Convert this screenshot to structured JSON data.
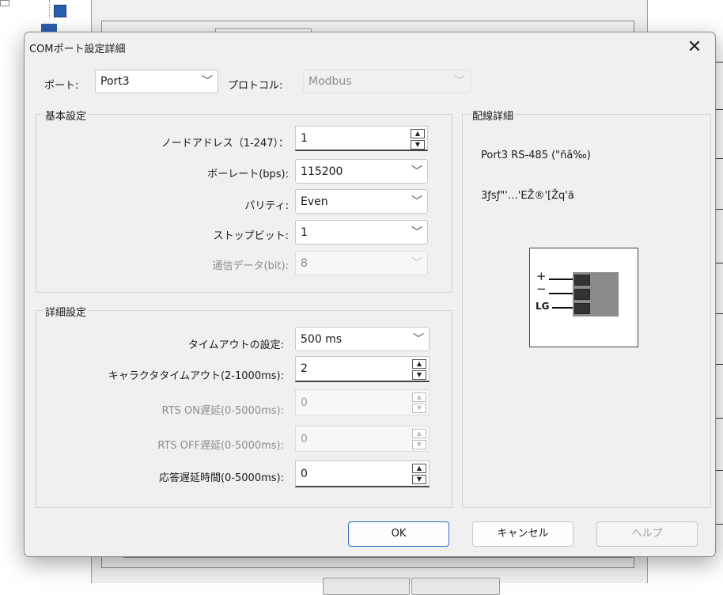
{
  "dialog": {
    "title": "COMポート設定詳細",
    "close_icon": "close-icon"
  },
  "top": {
    "port_label": "ポート:",
    "port_value": "Port3",
    "protocol_label": "プロトコル:",
    "protocol_value": "Modbus"
  },
  "basic": {
    "title": "基本設定",
    "node_label": "ノードアドレス（1-247）：",
    "node_value": "1",
    "baud_label": "ボーレート(bps):",
    "baud_value": "115200",
    "parity_label": "パリティ:",
    "parity_value": "Even",
    "stopbit_label": "ストップビット:",
    "stopbit_value": "1",
    "databit_label": "通信データ(bit):",
    "databit_value": "8"
  },
  "detail": {
    "title": "詳細設定",
    "timeout_label": "タイムアウトの設定:",
    "timeout_value": "500 ms",
    "char_timeout_label": "キャラクタタイムアウト(2-1000ms):",
    "char_timeout_value": "2",
    "rts_on_label": "RTS ON遅延(0-5000ms):",
    "rts_on_value": "0",
    "rts_off_label": "RTS OFF遅延(0-5000ms):",
    "rts_off_value": "0",
    "resp_delay_label": "応答遅延時間(0-5000ms):",
    "resp_delay_value": "0"
  },
  "wiring": {
    "title": "配線詳細",
    "line1": "Port3 RS-485 (\"ñâ‰)",
    "line2": "3ƒsƒ\"'…'EŽ®'[Žq'ä",
    "pin_plus": "+",
    "pin_minus": "−",
    "pin_lg": "LG"
  },
  "buttons": {
    "ok": "OK",
    "cancel": "キャンセル",
    "help": "ヘルプ"
  },
  "colors": {
    "accent": "#2f71c9",
    "dialog_bg": "#f0f0f0"
  }
}
